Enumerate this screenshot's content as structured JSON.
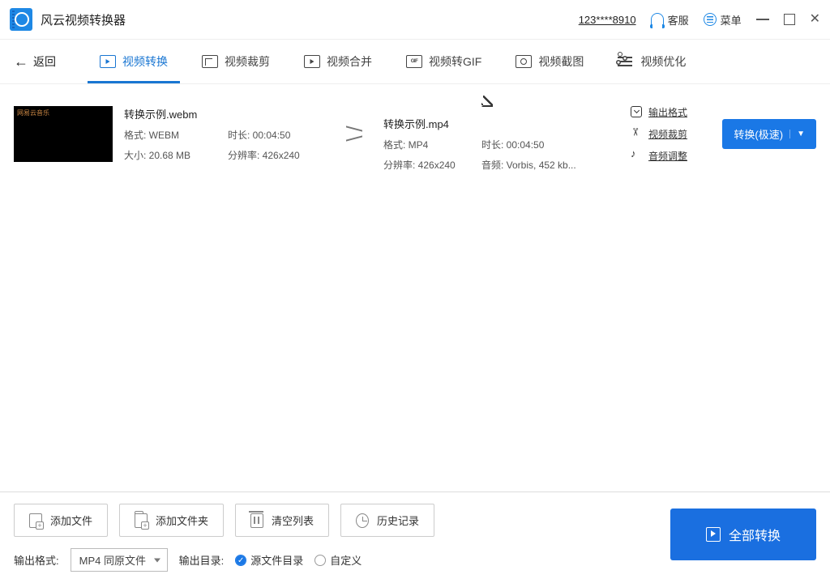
{
  "titlebar": {
    "app_name": "风云视频转换器",
    "user_id": "123****8910",
    "support": "客服",
    "menu": "菜单"
  },
  "nav": {
    "back": "返回",
    "tabs": {
      "convert": "视频转换",
      "crop": "视频裁剪",
      "merge": "视频合并",
      "gif": "视频转GIF",
      "screenshot": "视频截图",
      "optimize": "视频优化"
    }
  },
  "file": {
    "thumb_label": "网易云音乐",
    "source": {
      "name": "转换示例.webm",
      "format": "格式: WEBM",
      "duration": "时长: 00:04:50",
      "size": "大小: 20.68 MB",
      "resolution": "分辨率: 426x240"
    },
    "target": {
      "name": "转换示例.mp4",
      "format": "格式: MP4",
      "duration": "时长: 00:04:50",
      "resolution": "分辨率: 426x240",
      "audio": "音频: Vorbis, 452 kb..."
    },
    "actions": {
      "format": "输出格式",
      "crop": "视频裁剪",
      "audio": "音频调整"
    },
    "convert_btn": "转换(极速)"
  },
  "bottom": {
    "add_file": "添加文件",
    "add_folder": "添加文件夹",
    "clear": "清空列表",
    "history": "历史记录",
    "convert_all": "全部转换",
    "out_format_label": "输出格式:",
    "out_format_value": "MP4 同原文件",
    "out_dir_label": "输出目录:",
    "radio_source": "源文件目录",
    "radio_custom": "自定义"
  }
}
